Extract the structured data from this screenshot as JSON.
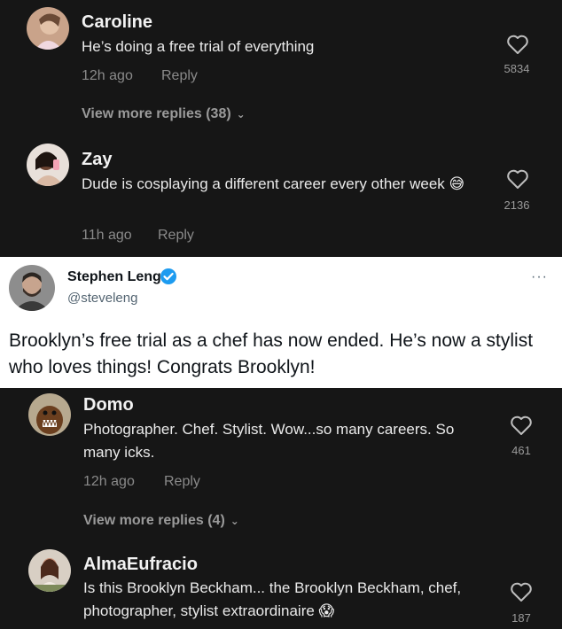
{
  "comments_top": [
    {
      "username": "Caroline",
      "text": "He’s doing a free trial of everything",
      "time": "12h ago",
      "reply_label": "Reply",
      "likes": "5834",
      "view_more": "View more replies (38)"
    },
    {
      "username": "Zay",
      "text": "Dude is cosplaying a different career every other week 😅",
      "time": "11h ago",
      "reply_label": "Reply",
      "likes": "2136"
    }
  ],
  "tweet": {
    "name": "Stephen Leng",
    "handle": "@steveleng",
    "more_icon": "···",
    "body": "Brooklyn’s free trial as a chef has now ended. He’s now a stylist who loves things! Congrats Brooklyn!",
    "verified_color": "#1d9bf0"
  },
  "comments_bottom": [
    {
      "username": "Domo",
      "text": "Photographer. Chef. Stylist. Wow...so many careers. So many icks.",
      "time": "12h ago",
      "reply_label": "Reply",
      "likes": "461",
      "view_more": "View more replies (4)"
    },
    {
      "username": "AlmaEufracio",
      "text": "Is this Brooklyn Beckham... the Brooklyn Beckham, chef, photographer, stylist extraordinaire 😱",
      "likes": "187"
    }
  ],
  "colors": {
    "background": "#161616",
    "muted_text": "#8a8a8a",
    "tweet_bg": "#ffffff"
  }
}
